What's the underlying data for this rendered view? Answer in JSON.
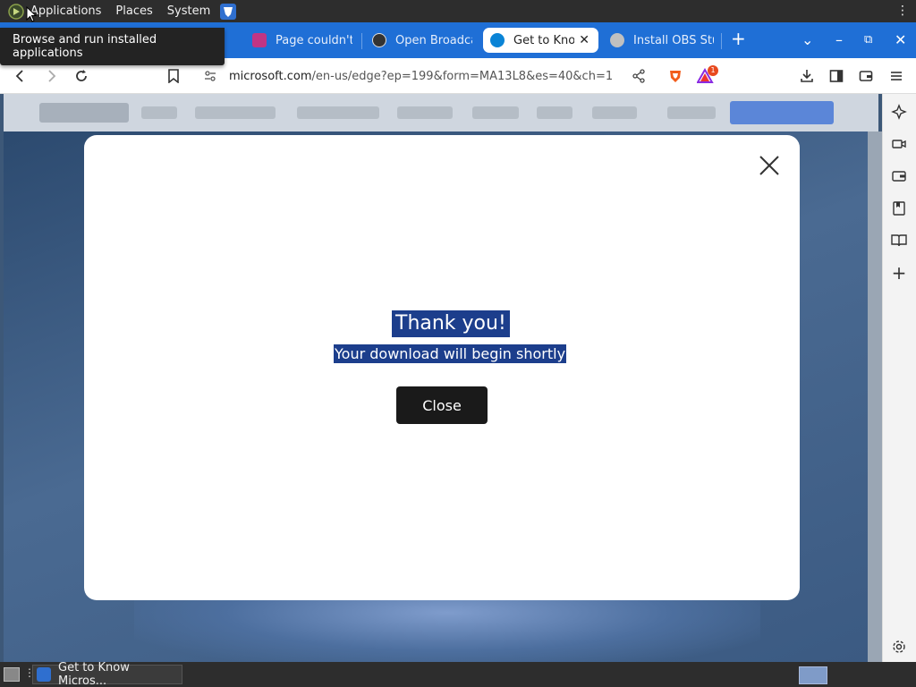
{
  "top_panel": {
    "menus": [
      "Applications",
      "Places",
      "System"
    ]
  },
  "tooltip": {
    "text": "Browse and run installed applications"
  },
  "tabs": [
    {
      "title": "Page couldn't load",
      "favicon_color": "#c13584",
      "active": false
    },
    {
      "title": "Open Broadcaster",
      "favicon_color": "#333333",
      "active": false
    },
    {
      "title": "Get to Know",
      "favicon_color": "#0a84d6",
      "active": true
    },
    {
      "title": "Install OBS Studio",
      "favicon_color": "#c0c0c0",
      "active": false
    }
  ],
  "toolbar": {
    "url_domain": "microsoft.com",
    "url_rest": "/en-us/edge?ep=199&form=MA13L8&es=40&ch=1",
    "brave_badge": "1"
  },
  "modal": {
    "title": "Thank you!",
    "subtitle": "Your download will begin shortly",
    "close_button_label": "Close"
  },
  "taskbar": {
    "window_title": "Get to Know Micros..."
  },
  "colors": {
    "tabstrip": "#1f6fd6",
    "highlight": "#1c3e8c",
    "modal_button": "#1a1a1a"
  }
}
